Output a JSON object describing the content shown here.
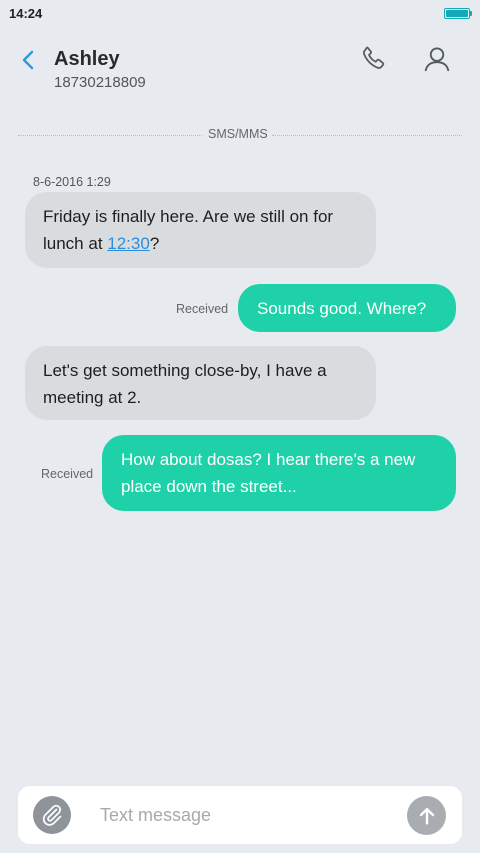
{
  "status_bar": {
    "time": "14:24",
    "battery_level": 1.0,
    "battery_icon": "battery-full-icon",
    "accent_color": "#14a9b6"
  },
  "header": {
    "contact_name": "Ashley",
    "contact_number": "18730218809",
    "back_icon": "chevron-left-icon",
    "call_icon": "phone-icon",
    "contact_icon": "person-icon"
  },
  "conversation": {
    "channel_label": "SMS/MMS",
    "timestamp": "8-6-2016 1:29",
    "messages": [
      {
        "direction": "incoming",
        "text_before": "Friday is finally here. Are we still on for lunch at ",
        "link": "12:30",
        "text_after": "?"
      },
      {
        "direction": "outgoing",
        "text": "Sounds good. Where?",
        "status": "Received"
      },
      {
        "direction": "incoming",
        "text": "Let's get something close-by, I have a meeting at 2."
      },
      {
        "direction": "outgoing",
        "text": "How about dosas? I hear there's a new place down the street...",
        "status": "Received"
      }
    ]
  },
  "composer": {
    "placeholder": "Text message",
    "value": "",
    "attach_icon": "paperclip-icon",
    "send_icon": "arrow-up-icon"
  },
  "colors": {
    "background": "#e7eaee",
    "incoming_bubble": "#d9dcdf",
    "outgoing_bubble": "#1fd1a9",
    "link": "#2a8ee0",
    "back_arrow": "#2a9ae0"
  }
}
